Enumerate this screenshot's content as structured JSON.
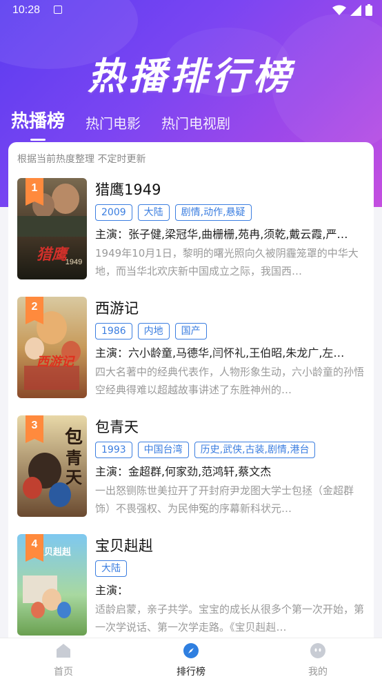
{
  "status_bar": {
    "time": "10:28"
  },
  "header": {
    "title": "热播排行榜"
  },
  "tabs": [
    {
      "label": "热播榜",
      "active": true
    },
    {
      "label": "热门电影",
      "active": false
    },
    {
      "label": "热门电视剧",
      "active": false
    }
  ],
  "list": {
    "hint": "根据当前热度整理 不定时更新",
    "items": [
      {
        "rank": "1",
        "title": "猎鹰1949",
        "poster_text": "1949",
        "tags": [
          "2009",
          "大陆",
          "剧情,动作,悬疑"
        ],
        "cast": "主演：张子健,梁冠华,曲栅栅,苑冉,须乾,戴云霞,严…",
        "desc": "1949年10月1日，黎明的曙光照向久被阴霾笼罩的中华大地，而当华北欢庆新中国成立之际，我国西…"
      },
      {
        "rank": "2",
        "title": "西游记",
        "poster_text": "西游记",
        "tags": [
          "1986",
          "内地",
          "国产"
        ],
        "cast": "主演：六小龄童,马德华,闫怀礼,王伯昭,朱龙广,左…",
        "desc": "四大名著中的经典代表作，人物形象生动，六小龄童的孙悟空经典得难以超越故事讲述了东胜神州的…"
      },
      {
        "rank": "3",
        "title": "包青天",
        "poster_text": "包青天",
        "tags": [
          "1993",
          "中国台湾",
          "历史,武侠,古装,剧情,港台"
        ],
        "cast": "主演：金超群,何家劲,范鸿轩,蔡文杰",
        "desc": "一出怒铡陈世美拉开了开封府尹龙图大学士包拯（金超群饰）不畏强权、为民伸冤的序幕新科状元…"
      },
      {
        "rank": "4",
        "title": "宝贝赳赳",
        "poster_text": "宝贝赳赳",
        "tags": [
          "大陆"
        ],
        "cast": "主演：",
        "desc": "适龄启蒙，亲子共学。宝宝的成长从很多个第一次开始，第一次学说话、第一次学走路。《宝贝赳赳…"
      }
    ]
  },
  "bottom_nav": [
    {
      "label": "首页",
      "active": false
    },
    {
      "label": "排行榜",
      "active": true
    },
    {
      "label": "我的",
      "active": false
    }
  ],
  "colors": {
    "accent": "#3a7de0",
    "rank_badge": "#ff8a3d",
    "gradient_start": "#5a3cf0",
    "gradient_end": "#c44fe0"
  }
}
